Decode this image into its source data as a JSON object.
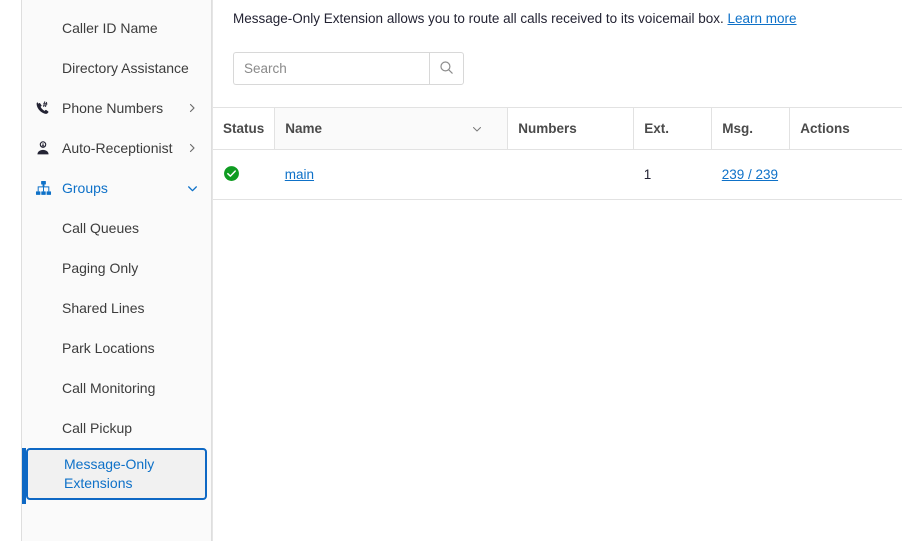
{
  "colors": {
    "accent_blue": "#0e71c8",
    "selected_border": "#0e68c4",
    "status_green": "#0f9c22",
    "sidebar_bg": "#fafafa",
    "text_dark": "#232333",
    "border": "#e2e2e2"
  },
  "sidebar": {
    "items": [
      {
        "label": "",
        "type": "partial",
        "icon": "",
        "chevron": ""
      },
      {
        "label": "Caller ID Name",
        "type": "child",
        "icon": "",
        "chevron": ""
      },
      {
        "label": "Directory Assistance",
        "type": "child",
        "icon": "",
        "chevron": ""
      },
      {
        "label": "Phone Numbers",
        "type": "parent",
        "icon": "phone-hash-icon",
        "chevron": "chevron-right-icon"
      },
      {
        "label": "Auto-Receptionist",
        "type": "parent",
        "icon": "receptionist-icon",
        "chevron": "chevron-right-icon"
      },
      {
        "label": "Groups",
        "type": "parent-expanded",
        "icon": "org-chart-icon",
        "chevron": "chevron-down-icon"
      },
      {
        "label": "Call Queues",
        "type": "child",
        "icon": "",
        "chevron": ""
      },
      {
        "label": "Paging Only",
        "type": "child",
        "icon": "",
        "chevron": ""
      },
      {
        "label": "Shared Lines",
        "type": "child",
        "icon": "",
        "chevron": ""
      },
      {
        "label": "Park Locations",
        "type": "child",
        "icon": "",
        "chevron": ""
      },
      {
        "label": "Call Monitoring",
        "type": "child",
        "icon": "",
        "chevron": ""
      },
      {
        "label": "Call Pickup",
        "type": "child",
        "icon": "",
        "chevron": ""
      },
      {
        "label": "Message-Only Extensions",
        "type": "selected",
        "icon": "",
        "chevron": ""
      }
    ]
  },
  "main": {
    "description_text": "Message-Only Extension allows you to route all calls received to its voicemail box.",
    "description_link": "Learn more",
    "search": {
      "value": "",
      "placeholder": "Search",
      "button_icon": "search-icon"
    },
    "table": {
      "columns": [
        {
          "key": "status",
          "label": "Status"
        },
        {
          "key": "name",
          "label": "Name"
        },
        {
          "key": "numbers",
          "label": "Numbers"
        },
        {
          "key": "ext",
          "label": "Ext."
        },
        {
          "key": "msg",
          "label": "Msg."
        },
        {
          "key": "actions",
          "label": "Actions"
        }
      ],
      "sort_column": "Name",
      "sort_icon": "chevron-down-icon",
      "rows": [
        {
          "status": "active",
          "status_icon": "check-circle-icon",
          "name": "main",
          "numbers": "",
          "ext": "1",
          "msg": "239 / 239",
          "actions": ""
        }
      ]
    }
  }
}
